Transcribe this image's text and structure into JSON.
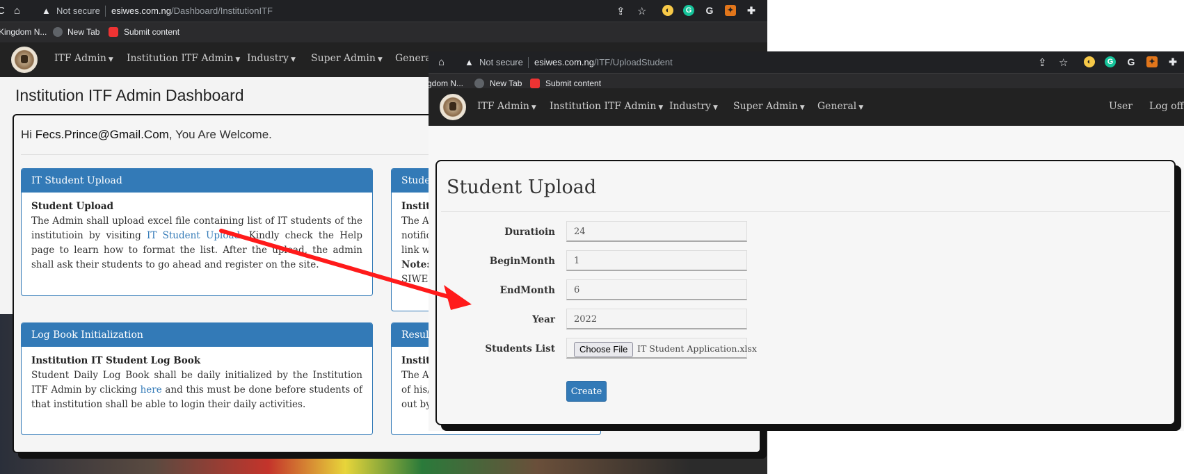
{
  "dashboard": {
    "browser": {
      "not_secure": "Not secure",
      "url_host": "esiwes.com.ng",
      "url_path": "/Dashboard/InstitutionITF"
    },
    "bookmarks": [
      "Kingdom N...",
      "New Tab",
      "Submit content"
    ],
    "nav": [
      "ITF Admin",
      "Institution ITF Admin",
      "Industry",
      "Super Admin",
      "General"
    ],
    "title": "Institution ITF Admin Dashboard",
    "welcome": {
      "hi": "Hi",
      "email": "Fecs.Prince@Gmail.Com",
      "rest": ", You Are Welcome."
    },
    "cards": {
      "upload": {
        "header": "IT Student Upload",
        "title": "Student Upload",
        "text_a": "The Admin shall upload excel file containing list of IT students of the institutioin by visiting ",
        "link": "IT Student Upload",
        "text_b": ". Kindly check the Help page to learn how to format the list. After the upload, the admin shall ask their students to go ahead and register on the site."
      },
      "logbook": {
        "header": "Log Book Initialization",
        "title": "Institution IT Student Log Book",
        "text_a": "Student Daily Log Book shall be daily initialized by the Institution ITF Admin by clicking ",
        "link": "here",
        "text_b": " and this must be done before students of that institution shall be able to login their daily activities."
      },
      "partial_top": {
        "header": "Studen",
        "line1": "Institu",
        "line2": "The Ad",
        "line3": "notific",
        "line4": "link wh",
        "line5": "Note: s",
        "line6": "SIWES"
      },
      "partial_bottom": {
        "header": "Result",
        "line1": "Institu",
        "line2": "The Ad",
        "line3": "of his/",
        "line4": "out by"
      }
    }
  },
  "upload_page": {
    "browser": {
      "not_secure": "Not secure",
      "url_host": "esiwes.com.ng",
      "url_path": "/ITF/UploadStudent"
    },
    "bookmarks": [
      "gdom N...",
      "New Tab",
      "Submit content"
    ],
    "nav": [
      "ITF Admin",
      "Institution ITF Admin",
      "Industry",
      "Super Admin",
      "General"
    ],
    "nav_right": [
      "User",
      "Log off"
    ],
    "title": "Student Upload",
    "fields": [
      {
        "label": "Duratioin",
        "value": "24"
      },
      {
        "label": "BeginMonth",
        "value": "1"
      },
      {
        "label": "EndMonth",
        "value": "6"
      },
      {
        "label": "Year",
        "value": "2022"
      }
    ],
    "students_list": {
      "label": "Students List",
      "button": "Choose File",
      "filename": "IT Student Application.xlsx"
    },
    "create_button": "Create"
  },
  "colors": {
    "primary": "#337ab7",
    "navbar": "#222222",
    "chrome": "#202124",
    "arrow": "#ff0000"
  }
}
